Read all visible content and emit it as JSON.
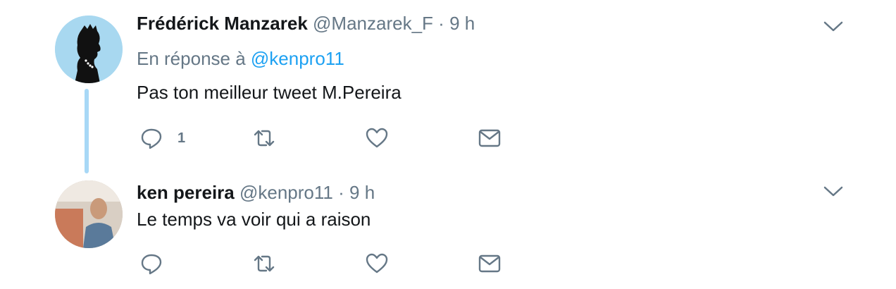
{
  "tweets": [
    {
      "author_name": "Frédérick Manzarek",
      "handle": "@Manzarek_F",
      "separator": "·",
      "time": "9 h",
      "reply_prefix": "En réponse à",
      "reply_mention": "@kenpro11",
      "text": "Pas ton meilleur tweet M.Pereira",
      "reply_count": "1",
      "avatar_bg": "#a8d8f0"
    },
    {
      "author_name": "ken pereira",
      "handle": "@kenpro11",
      "separator": "·",
      "time": "9 h",
      "text": "Le temps va voir qui a raison",
      "reply_count": "",
      "avatar_bg": "#c9b8a8"
    }
  ],
  "icons": {
    "reply": "reply-icon",
    "retweet": "retweet-icon",
    "like": "heart-icon",
    "message": "envelope-icon",
    "more": "chevron-down-icon"
  },
  "colors": {
    "link": "#1da1f2",
    "muted": "#657786",
    "thread_line": "#a8d8f6"
  }
}
